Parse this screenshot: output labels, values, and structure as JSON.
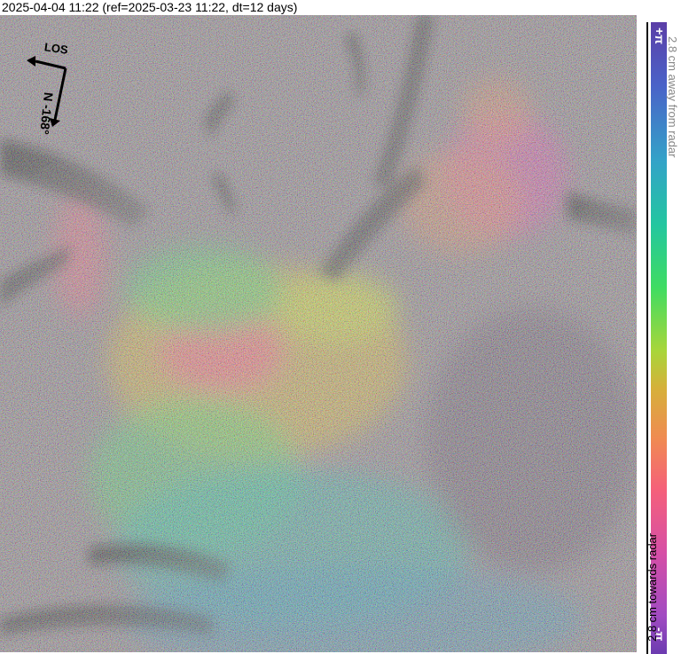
{
  "header": {
    "title": "2025-04-04 11:22 (ref=2025-03-23 11:22, dt=12 days)"
  },
  "compass": {
    "north_label": "N",
    "heading_label": "-168°",
    "los_label": "LOS"
  },
  "colorbar": {
    "top_tick": "+π",
    "bottom_tick": "-π",
    "away_label": "2.8 cm away from radar",
    "towards_label": "2.8 cm towards radar"
  },
  "colors": {
    "background": "#ffffff",
    "phase_min": "#6b3bb0",
    "phase_mid": "#3fdc62",
    "phase_max": "#5b3ea7"
  }
}
